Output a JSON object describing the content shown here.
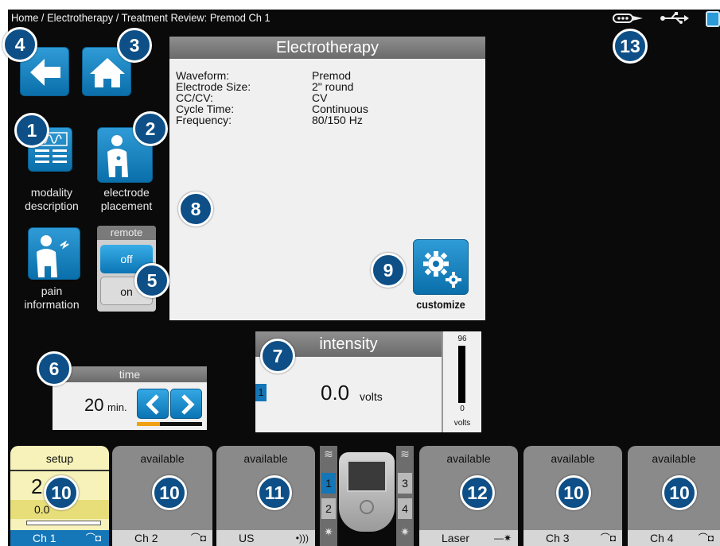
{
  "breadcrumb": "Home / Electrotherapy / Treatment Review: Premod Ch 1",
  "badges": {
    "b1": "1",
    "b2": "2",
    "b3": "3",
    "b4": "4",
    "b5": "5",
    "b6": "6",
    "b7": "7",
    "b8": "8",
    "b9": "9",
    "b10": "10",
    "b11": "11",
    "b12": "12",
    "b13": "13"
  },
  "tiles": {
    "modality": "modality\ndescription",
    "electrode": "electrode\nplacement",
    "pain": "pain\ninformation"
  },
  "remote": {
    "title": "remote",
    "off": "off",
    "on": "on"
  },
  "panel": {
    "title": "Electrotherapy",
    "params": [
      {
        "key": "Waveform:",
        "value": "Premod"
      },
      {
        "key": "Electrode Size:",
        "value": "2\" round"
      },
      {
        "key": "CC/CV:",
        "value": "CV"
      },
      {
        "key": "Cycle Time:",
        "value": "Continuous"
      },
      {
        "key": "Frequency:",
        "value": "80/150 Hz"
      }
    ],
    "customize_label": "customize"
  },
  "time": {
    "title": "time",
    "value": "20",
    "unit": "min.",
    "progress": 0.35
  },
  "intensity": {
    "title": "intensity",
    "channel": "1",
    "value": "0.0",
    "unit": "volts",
    "scale_max": "96",
    "scale_min": "0",
    "scale_unit": "volts",
    "level": 0.0
  },
  "channels": [
    {
      "status": "setup",
      "name": "Ch 1",
      "symbol": "electrode",
      "reading": "2",
      "reading_sub": "0.0"
    },
    {
      "status": "available",
      "name": "Ch 2",
      "symbol": "electrode"
    },
    {
      "status": "available",
      "name": "US",
      "symbol": "ultrasound"
    },
    {
      "status": "available",
      "name": "Laser",
      "symbol": "laser"
    },
    {
      "status": "available",
      "name": "Ch 3",
      "symbol": "electrode"
    },
    {
      "status": "available",
      "name": "Ch 4",
      "symbol": "electrode"
    }
  ],
  "device": {
    "slot1": "1",
    "slot2": "2",
    "slot3": "3",
    "slot4": "4"
  },
  "colors": {
    "accent": "#0b74b4",
    "badge": "#0d4f86",
    "panel": "#f0f0f0",
    "setup": "#f6f2b9"
  }
}
